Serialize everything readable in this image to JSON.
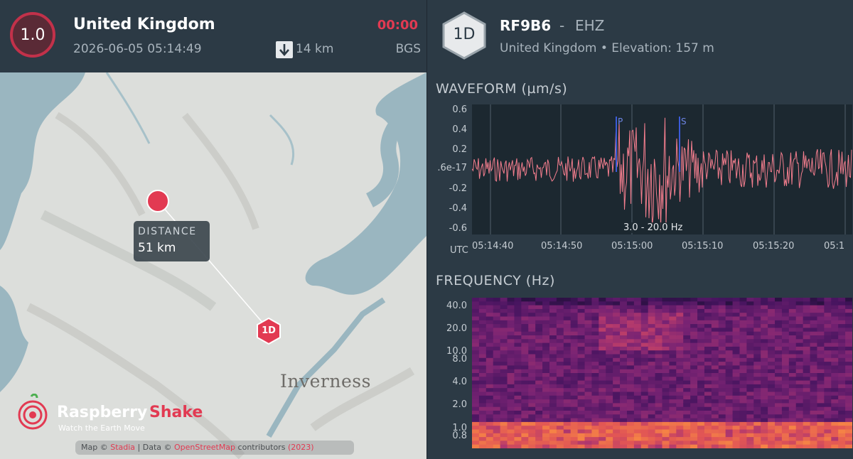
{
  "event": {
    "magnitude": "1.0",
    "region": "United Kingdom",
    "datetime": "2026-06-05 05:14:49",
    "depth": "14 km",
    "countdown": "00:00",
    "source": "BGS"
  },
  "map": {
    "city": "Inverness",
    "distance_title": "DISTANCE",
    "distance_value": "51 km",
    "station_marker": "1D",
    "logo_word1": "Raspberry",
    "logo_word2": "Shake",
    "logo_reg": "®",
    "tagline": "Watch the Earth Move",
    "attribution_prefix": "Map ©",
    "attribution_link1": "Stadia",
    "attribution_mid": " | Data ©",
    "attribution_link2": "OpenStreetMap",
    "attribution_suffix": " contributors",
    "attribution_link3": "(2023)"
  },
  "station": {
    "badge": "1D",
    "code": "RF9B6",
    "separator": "-",
    "channel": "EHZ",
    "location": "United Kingdom • Elevation: 157 m"
  },
  "waveform": {
    "title": "WAVEFORM (µm/s)",
    "y_ticks": [
      "0.6",
      "0.4",
      "0.2",
      ".6e-17",
      "-0.2",
      "-0.4",
      "-0.6"
    ],
    "x_ticks": [
      "05:14:40",
      "05:14:50",
      "05:15:00",
      "05:15:10",
      "05:15:20",
      "05:1"
    ],
    "tz_label": "UTC",
    "filter": "3.0 - 20.0 Hz",
    "p_label": "P",
    "s_label": "S",
    "color": "#f47e8e"
  },
  "frequency": {
    "title": "FREQUENCY (Hz)",
    "y_ticks": [
      "40.0",
      "20.0",
      "10.0",
      "8.0",
      "4.0",
      "2.0",
      "1.0",
      "0.8"
    ]
  },
  "colors": {
    "accent": "#e23a52",
    "panel": "#2c3a45"
  }
}
